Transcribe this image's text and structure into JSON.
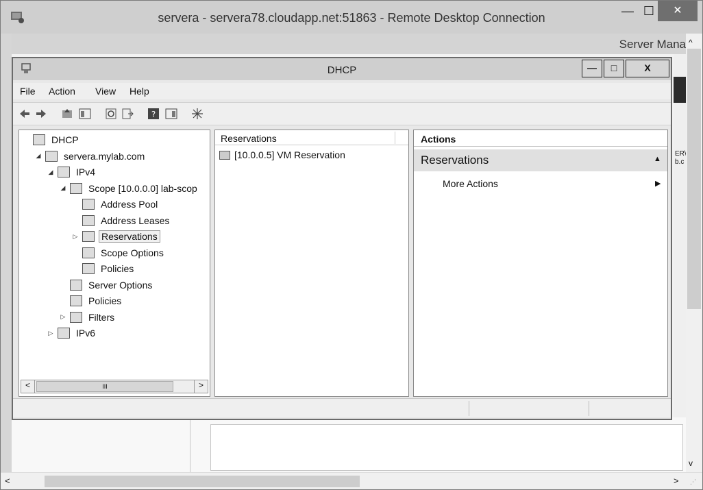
{
  "rdp": {
    "title": "servera - servera78.cloudapp.net:51863 - Remote Desktop Connection",
    "minimize": "—",
    "maximize": "☐",
    "close": "✕"
  },
  "server_manager": {
    "title": "Server Mana",
    "right_text_1": "ER\\",
    "right_text_2": "b.c"
  },
  "dhcp_window": {
    "title": "DHCP",
    "minimize": "—",
    "maximize": "□",
    "close": "X"
  },
  "menu": [
    "File",
    "Action",
    "View",
    "Help"
  ],
  "toolbar_icons": [
    "back-icon",
    "forward-icon",
    "up-folder-icon",
    "show-hide-tree-icon",
    "refresh-icon",
    "export-list-icon",
    "help-icon",
    "show-hide-action-pane-icon",
    "dhcp-star-icon"
  ],
  "tree": {
    "nodes": [
      {
        "label": "DHCP",
        "level": 0,
        "expander": "",
        "icon": "dhcp-icon"
      },
      {
        "label": "servera.mylab.com",
        "level": 1,
        "expander": "◢",
        "icon": "server-icon"
      },
      {
        "label": "IPv4",
        "level": 2,
        "expander": "◢",
        "icon": "ipv4-icon"
      },
      {
        "label": "Scope [10.0.0.0] lab-scop",
        "level": 3,
        "expander": "◢",
        "icon": "scope-folder-icon"
      },
      {
        "label": "Address Pool",
        "level": 4,
        "expander": "",
        "icon": "address-pool-icon"
      },
      {
        "label": "Address Leases",
        "level": 4,
        "expander": "",
        "icon": "address-leases-icon"
      },
      {
        "label": "Reservations",
        "level": 4,
        "expander": "▷",
        "icon": "reservations-icon",
        "selected": true
      },
      {
        "label": "Scope Options",
        "level": 4,
        "expander": "",
        "icon": "scope-options-icon"
      },
      {
        "label": "Policies",
        "level": 4,
        "expander": "",
        "icon": "policies-icon"
      },
      {
        "label": "Server Options",
        "level": 3,
        "expander": "",
        "icon": "server-options-icon"
      },
      {
        "label": "Policies",
        "level": 3,
        "expander": "",
        "icon": "policies-icon"
      },
      {
        "label": "Filters",
        "level": 3,
        "expander": "▷",
        "icon": "filters-icon"
      },
      {
        "label": "IPv6",
        "level": 2,
        "expander": "▷",
        "icon": "ipv6-icon"
      }
    ],
    "scroll_left": "<",
    "scroll_thumb": "III",
    "scroll_right": ">"
  },
  "center": {
    "column_header": "Reservations",
    "rows": [
      "[10.0.0.5] VM Reservation"
    ]
  },
  "actions": {
    "header": "Actions",
    "group": "Reservations",
    "group_arrow": "▲",
    "more_actions": "More Actions",
    "more_arrow": "▶"
  },
  "scrollbars": {
    "v_up": "^",
    "v_down": "v",
    "h_left": "<",
    "h_right": ">",
    "grip": "⋰"
  }
}
